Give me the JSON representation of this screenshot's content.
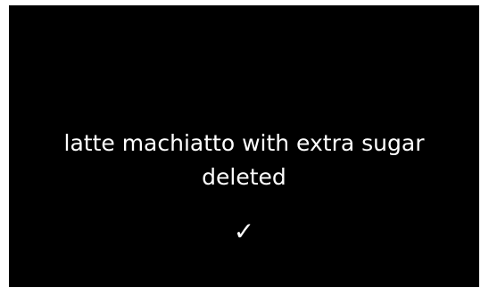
{
  "notification": {
    "item_name": "latte machiatto with extra sugar",
    "status_text": "deleted",
    "confirm_icon": "checkmark-icon",
    "confirm_glyph": "✓"
  },
  "colors": {
    "screen_background": "#000000",
    "text": "#ffffff",
    "frame": "#ffffff"
  }
}
